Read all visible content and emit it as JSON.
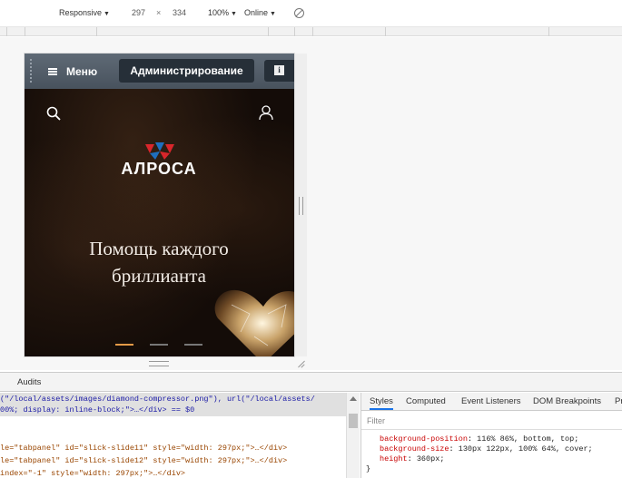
{
  "device_toolbar": {
    "device": "Responsive",
    "width": "297",
    "sep": "×",
    "height": "334",
    "zoom": "100%",
    "network": "Online"
  },
  "site": {
    "menu_label": "Меню",
    "admin_label": "Администрирование",
    "info_label": "i",
    "logo_text": "АЛРОСА",
    "hero_title": "Помощь каждого бриллианта",
    "slides": 3,
    "active_slide": 0
  },
  "devtools": {
    "drawer_tab": "Audits",
    "elements_lines": [
      {
        "attr_pre": "(\"/local/assets/images/diamond-compressor.png\"), url(\"/local/assets/",
        "type": "plain"
      },
      {
        "text": "00%; display: inline-block;\">…</div> == $0",
        "type": "sel"
      },
      {
        "text": "le=\"tabpanel\" id=\"slick-slide11\" style=\"width: 297px;\">…</div>",
        "type": "row"
      },
      {
        "text": "le=\"tabpanel\" id=\"slick-slide12\" style=\"width: 297px;\">…</div>",
        "type": "row"
      },
      {
        "text": "index=\"-1\" style=\"width: 297px;\">…</div>",
        "type": "row"
      }
    ],
    "styles_tabs": [
      "Styles",
      "Computed",
      "Event Listeners",
      "DOM Breakpoints",
      "Pr"
    ],
    "filter_placeholder": "Filter",
    "css": [
      {
        "prop": "background-position",
        "value": "116% 86%, bottom, top;"
      },
      {
        "prop": "background-size",
        "value": "130px 122px, 100% 64%, cover;"
      },
      {
        "prop": "height",
        "value": "360px;"
      }
    ],
    "closing_brace": "}"
  },
  "colors": {
    "site_bar": "#525c67",
    "admin_btn": "#262f38",
    "active_dot": "#e39a47",
    "hero_bg": "#140c08"
  }
}
